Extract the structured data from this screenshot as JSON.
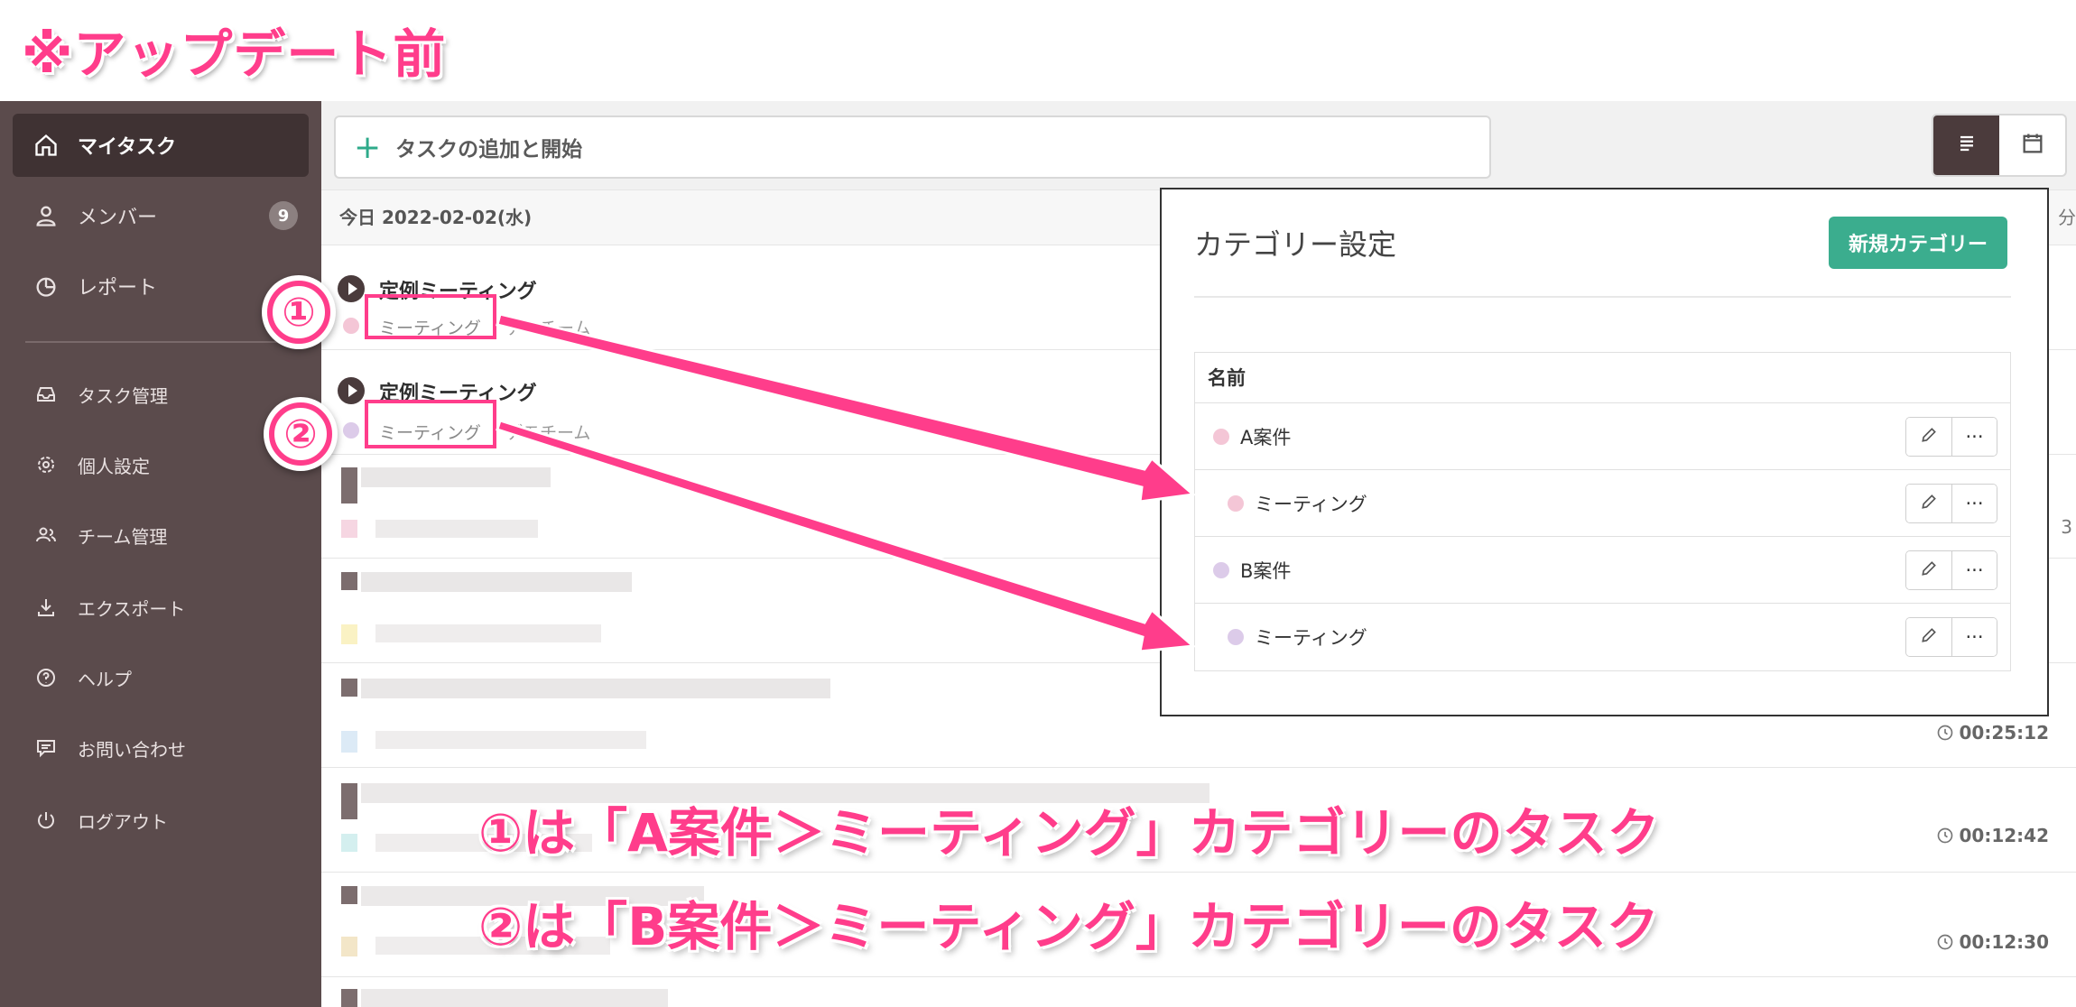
{
  "annotation": {
    "top_note": "※アップデート前",
    "marker_1": "①",
    "marker_2": "②",
    "caption_1": "①は「A案件＞ミーティング」カテゴリーのタスク",
    "caption_2": "②は「B案件＞ミーティング」カテゴリーのタスク",
    "accent_color": "#ff3d8b"
  },
  "sidebar": {
    "items": [
      {
        "label": "マイタスク",
        "icon": "home-icon"
      },
      {
        "label": "メンバー",
        "icon": "user-icon",
        "badge": "9"
      },
      {
        "label": "レポート",
        "icon": "pie-chart-icon"
      },
      {
        "label": "タスク管理",
        "icon": "inbox-icon"
      },
      {
        "label": "個人設定",
        "icon": "gear-icon"
      },
      {
        "label": "チーム管理",
        "icon": "team-icon"
      },
      {
        "label": "エクスポート",
        "icon": "download-icon"
      },
      {
        "label": "ヘルプ",
        "icon": "help-icon"
      },
      {
        "label": "お問い合わせ",
        "icon": "message-icon"
      },
      {
        "label": "ログアウト",
        "icon": "power-icon"
      }
    ]
  },
  "toolbar": {
    "add_task_label": "タスクの追加と開始",
    "view_list": "list-view-icon",
    "view_calendar": "calendar-view-icon"
  },
  "task_list": {
    "date_header": "今日 2022-02-02(水)",
    "date_tail": "分",
    "tasks": [
      {
        "title": "定例ミーティング",
        "category": "ミーティング",
        "team": "デモチーム",
        "dot_color": "#f4c6d6"
      },
      {
        "title": "定例ミーティング",
        "category": "ミーティング",
        "team": "デモチーム",
        "dot_color": "#dccbe9"
      }
    ],
    "timers": [
      "00:25:12",
      "00:12:42",
      "00:12:30"
    ],
    "edge_fragment": "3"
  },
  "category_modal": {
    "title": "カテゴリー設定",
    "new_button": "新規カテゴリー",
    "column_name": "名前",
    "rows": [
      {
        "name": "A案件",
        "dot_color": "#f4c6d6",
        "level": 0
      },
      {
        "name": "ミーティング",
        "dot_color": "#f4c6d6",
        "level": 1
      },
      {
        "name": "B案件",
        "dot_color": "#dccbe9",
        "level": 0
      },
      {
        "name": "ミーティング",
        "dot_color": "#dccbe9",
        "level": 1
      }
    ],
    "more_glyph": "···"
  }
}
